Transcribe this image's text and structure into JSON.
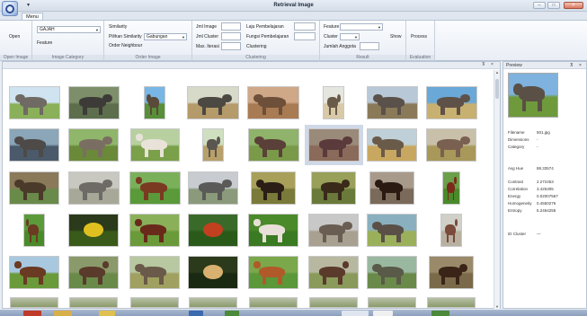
{
  "window": {
    "title": "Retrieval Image",
    "quick_access": "▾"
  },
  "tabs": [
    {
      "label": "Menu"
    }
  ],
  "ribbon": {
    "open_image": {
      "button": "Open",
      "caption": "Open Image"
    },
    "image_category": {
      "combo_value": "GAJAH",
      "feature_label": "Feature",
      "caption": "Image Category"
    },
    "order_image": {
      "similarity_label": "Similarity",
      "pilihan_label": "Pilihan Similarity",
      "pilihan_value": "Gabungan",
      "order_neighbour_label": "Order Neighbour",
      "caption": "Order Image"
    },
    "clustering": {
      "jml_image": "Jml Image",
      "jml_cluster": "Jml Cluster",
      "max_iterasi": "Max. Iterasi",
      "laju": "Laju Pembelajaran",
      "fungsi": "Fungsi Pembelajaran",
      "clustering": "Clustering",
      "caption": "Clustering"
    },
    "result": {
      "feature_label": "Feature",
      "cluster_label": "Cluster",
      "jumlah_label": "Jumlah Anggota",
      "show_button": "Show",
      "caption": "Result"
    },
    "evaluation": {
      "process_button": "Process",
      "caption": "Evaluation"
    }
  },
  "colors": {
    "window_bg": "#e9edf2",
    "panel_border": "#b9c4d3",
    "accent": "#2d4f93"
  },
  "gallery": {
    "thumbs": [
      {
        "subject": "elephant",
        "sky": "#cfe3f0",
        "ground": "#8ab05a",
        "animal": "#6f6a63"
      },
      {
        "subject": "elephant",
        "sky": "#7d8f6a",
        "ground": "#5d6e4d",
        "animal": "#3d3b38"
      },
      {
        "subject": "elephant",
        "sky": "#78b6e6",
        "ground": "#5a8f3a",
        "animal": "#5a4a3a"
      },
      {
        "subject": "elephant",
        "sky": "#d7d9c9",
        "ground": "#b59a6a",
        "animal": "#4c4842"
      },
      {
        "subject": "elephant",
        "sky": "#cfa888",
        "ground": "#a97b53",
        "animal": "#6d4f3a"
      },
      {
        "subject": "elephant",
        "sky": "#e6e6e0",
        "ground": "#d8c9a8",
        "animal": "#6a5a48"
      },
      {
        "subject": "elephant",
        "sky": "#b9c8d6",
        "ground": "#8a7a5a",
        "animal": "#5a524a"
      },
      {
        "subject": "elephant",
        "sky": "#6aa8d8",
        "ground": "#c8b070",
        "animal": "#5e5148"
      },
      {
        "subject": "elephant",
        "sky": "#8aa6b8",
        "ground": "#4a5a6a",
        "animal": "#4d4a48"
      },
      {
        "subject": "elephant",
        "sky": "#8fb66a",
        "ground": "#6a8a3a",
        "animal": "#7a6e62"
      },
      {
        "subject": "horse",
        "sky": "#b8d0a0",
        "ground": "#7aa04a",
        "animal": "#e8e2d8"
      },
      {
        "subject": "elephant",
        "sky": "#cfe0c0",
        "ground": "#b8a06a",
        "animal": "#5a5650"
      },
      {
        "subject": "elephant",
        "sky": "#8fb36a",
        "ground": "#7a9a4a",
        "animal": "#5a4038"
      },
      {
        "subject": "elephant",
        "sky": "#9a8a7a",
        "ground": "#8a6a5a",
        "animal": "#5a3a3a"
      },
      {
        "subject": "elephant",
        "sky": "#c0d0d8",
        "ground": "#c8a860",
        "animal": "#6a5a4a"
      },
      {
        "subject": "elephant",
        "sky": "#c8c0a8",
        "ground": "#a8985a",
        "animal": "#7a6050"
      },
      {
        "subject": "elephant",
        "sky": "#8a7a5a",
        "ground": "#6a8a4a",
        "animal": "#4a3a2a"
      },
      {
        "subject": "elephant",
        "sky": "#c8c8c0",
        "ground": "#a8a898",
        "animal": "#6e6a66"
      },
      {
        "subject": "horse",
        "sky": "#7ab05a",
        "ground": "#5a9a3a",
        "animal": "#7a3a22"
      },
      {
        "subject": "elephant",
        "sky": "#c8ccd0",
        "ground": "#8a9a7a",
        "animal": "#5a5a58"
      },
      {
        "subject": "bear",
        "sky": "#a8a05a",
        "ground": "#7a7a3a",
        "animal": "#2a1e16"
      },
      {
        "subject": "bear",
        "sky": "#98a05a",
        "ground": "#6a7a3a",
        "animal": "#3a2a1a"
      },
      {
        "subject": "bear",
        "sky": "#a89a8a",
        "ground": "#7a6a5a",
        "animal": "#2a1a12"
      },
      {
        "subject": "horse",
        "sky": "#6aa04a",
        "ground": "#4a8a2a",
        "animal": "#7a2a1a"
      },
      {
        "subject": "horse",
        "sky": "#5a9a3a",
        "ground": "#4a8a2a",
        "animal": "#6a3a22"
      },
      {
        "subject": "flower",
        "sky": "#2a3a1a",
        "ground": "#3a5a1a",
        "animal": "#e0c020"
      },
      {
        "subject": "horse",
        "sky": "#8ab05a",
        "ground": "#6a9a3a",
        "animal": "#6a2a1a"
      },
      {
        "subject": "flower",
        "sky": "#3a6a2a",
        "ground": "#2a5a1a",
        "animal": "#c04020"
      },
      {
        "subject": "horse",
        "sky": "#4a8a2a",
        "ground": "#3a7a22",
        "animal": "#e8e0d8"
      },
      {
        "subject": "elephant",
        "sky": "#c8c8c8",
        "ground": "#a8a090",
        "animal": "#6a5e52"
      },
      {
        "subject": "elephant",
        "sky": "#8ab0c0",
        "ground": "#9ab05a",
        "animal": "#5a5048"
      },
      {
        "subject": "horse",
        "sky": "#d0d0c8",
        "ground": "#b8b0a0",
        "animal": "#7a4a3a"
      },
      {
        "subject": "horse",
        "sky": "#a8c8e0",
        "ground": "#6a9a3a",
        "animal": "#6a3a22"
      },
      {
        "subject": "horse",
        "sky": "#8a9a6a",
        "ground": "#6a8a4a",
        "animal": "#5a3a2a"
      },
      {
        "subject": "elephant",
        "sky": "#b8c8a0",
        "ground": "#a0a060",
        "animal": "#6a5a4a"
      },
      {
        "subject": "butterfly",
        "sky": "#2a3a1a",
        "ground": "#1a2a12",
        "animal": "#d8b070"
      },
      {
        "subject": "horse",
        "sky": "#7aa84a",
        "ground": "#5a983a",
        "animal": "#b05a2a"
      },
      {
        "subject": "horse",
        "sky": "#b8b8a0",
        "ground": "#8a9a5a",
        "animal": "#5a3a2a"
      },
      {
        "subject": "elephant",
        "sky": "#9ab8a0",
        "ground": "#6a8a4a",
        "animal": "#5a5a48"
      },
      {
        "subject": "bear",
        "sky": "#9a8a6a",
        "ground": "#7a6a4a",
        "animal": "#3a2418"
      }
    ]
  },
  "preview": {
    "title": "Preview",
    "image": {
      "sky": "#7fb2de",
      "ground": "#6e9a3c",
      "animal": "#5a5046"
    },
    "rows": [
      {
        "label": "Filename",
        "value": "501.jpg"
      },
      {
        "label": "Dimensions",
        "value": "-"
      },
      {
        "label": "Category",
        "value": "-"
      },
      {
        "label": "Avg Hue",
        "value": "88.33574"
      },
      {
        "label": "Contrast",
        "value": "2.272453"
      },
      {
        "label": "Correlation",
        "value": "3.425305"
      },
      {
        "label": "Energy",
        "value": "0.02007567"
      },
      {
        "label": "Homogeneity",
        "value": "0.4550276"
      },
      {
        "label": "Entropy",
        "value": "5.2464255"
      },
      {
        "label": "ID Cluster",
        "value": "—"
      }
    ]
  }
}
